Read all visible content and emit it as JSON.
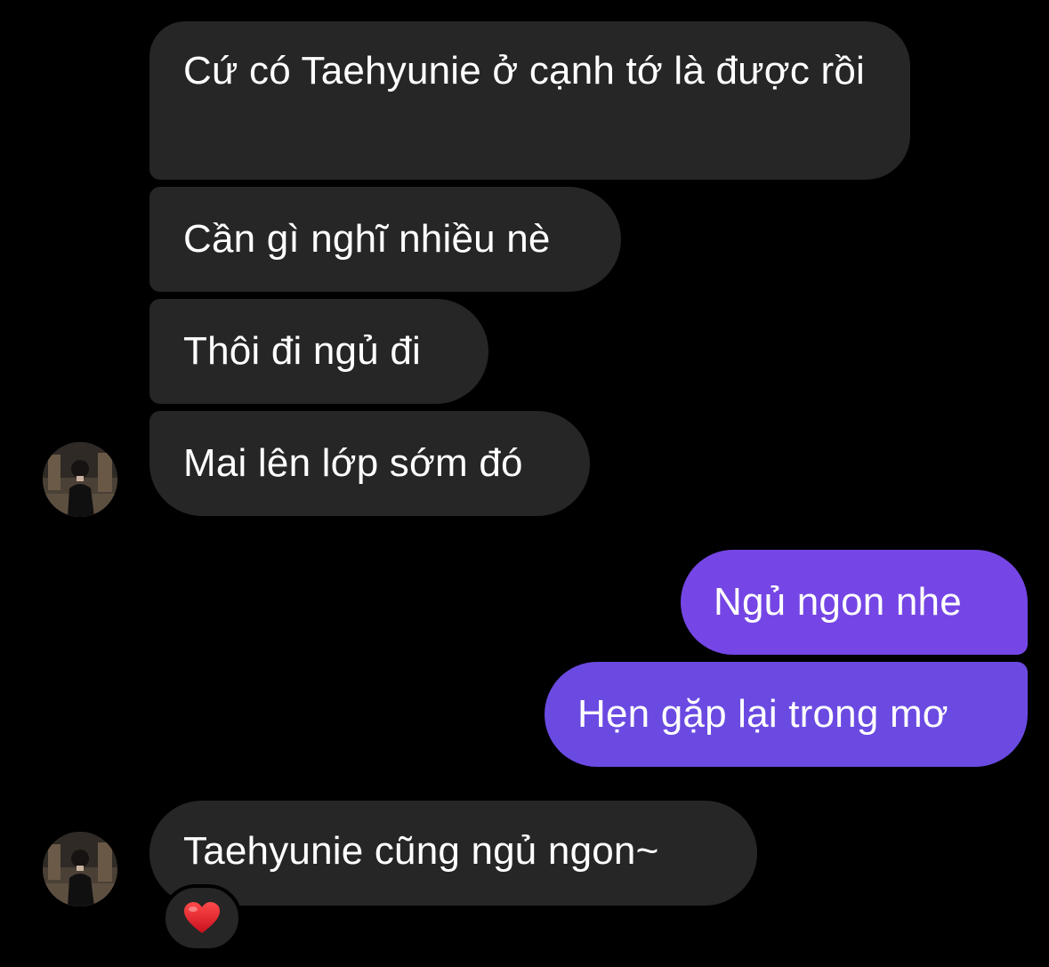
{
  "colors": {
    "background": "#000000",
    "incoming_bubble": "#262626",
    "outgoing_bubble": "#6e48e4",
    "text": "#ffffff",
    "reaction_heart": "#e0202b"
  },
  "messages": [
    {
      "direction": "incoming",
      "text": "Cứ có Taehyunie ở cạnh tớ là được rồi"
    },
    {
      "direction": "incoming",
      "text": "Cần gì nghĩ nhiều nè"
    },
    {
      "direction": "incoming",
      "text": "Thôi đi ngủ đi"
    },
    {
      "direction": "incoming",
      "text": "Mai lên lớp sớm đó"
    },
    {
      "direction": "outgoing",
      "text": "Ngủ ngon nhe"
    },
    {
      "direction": "outgoing",
      "text": "Hẹn gặp lại trong mơ"
    },
    {
      "direction": "incoming",
      "text": "Taehyunie cũng ngủ ngon~"
    }
  ],
  "reaction": {
    "icon": "heart-icon"
  },
  "avatar": {
    "icon": "avatar-photo"
  }
}
